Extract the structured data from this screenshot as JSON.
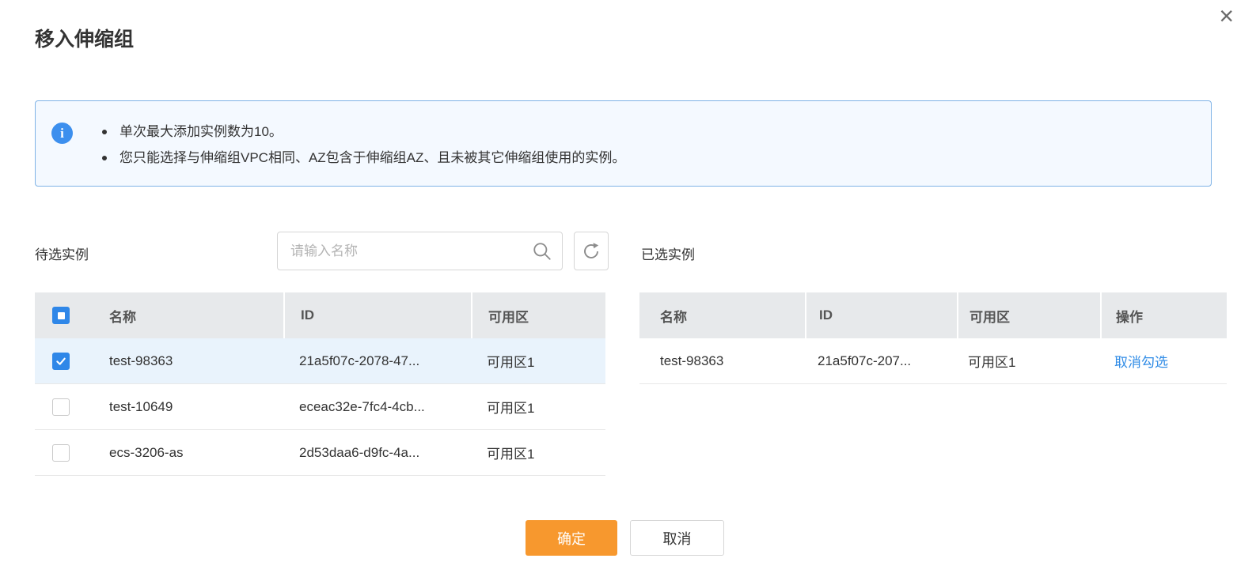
{
  "dialog": {
    "title": "移入伸缩组",
    "close_glyph": "×"
  },
  "notice": {
    "icon_glyph": "i",
    "items": [
      "单次最大添加实例数为10。",
      "您只能选择与伸缩组VPC相同、AZ包含于伸缩组AZ、且未被其它伸缩组使用的实例。"
    ]
  },
  "available": {
    "label": "待选实例",
    "search_placeholder": "请输入名称",
    "columns": [
      "名称",
      "ID",
      "可用区"
    ],
    "rows": [
      {
        "name": "test-98363",
        "id": "21a5f07c-2078-47...",
        "az": "可用区1",
        "checked": true
      },
      {
        "name": "test-10649",
        "id": "eceac32e-7fc4-4cb...",
        "az": "可用区1",
        "checked": false
      },
      {
        "name": "ecs-3206-as",
        "id": "2d53daa6-d9fc-4a...",
        "az": "可用区1",
        "checked": false
      }
    ]
  },
  "selected": {
    "label": "已选实例",
    "columns": [
      "名称",
      "ID",
      "可用区",
      "操作"
    ],
    "rows": [
      {
        "name": "test-98363",
        "id": "21a5f07c-207...",
        "az": "可用区1",
        "action": "取消勾选"
      }
    ]
  },
  "footer": {
    "ok": "确定",
    "cancel": "取消"
  },
  "colors": {
    "accent_blue": "#2f87e8",
    "accent_orange": "#f7982e",
    "banner_border": "#7fb3e6",
    "banner_bg": "#f4f9ff",
    "header_bg": "#e7e9eb",
    "selected_row_bg": "#e9f3fc"
  }
}
